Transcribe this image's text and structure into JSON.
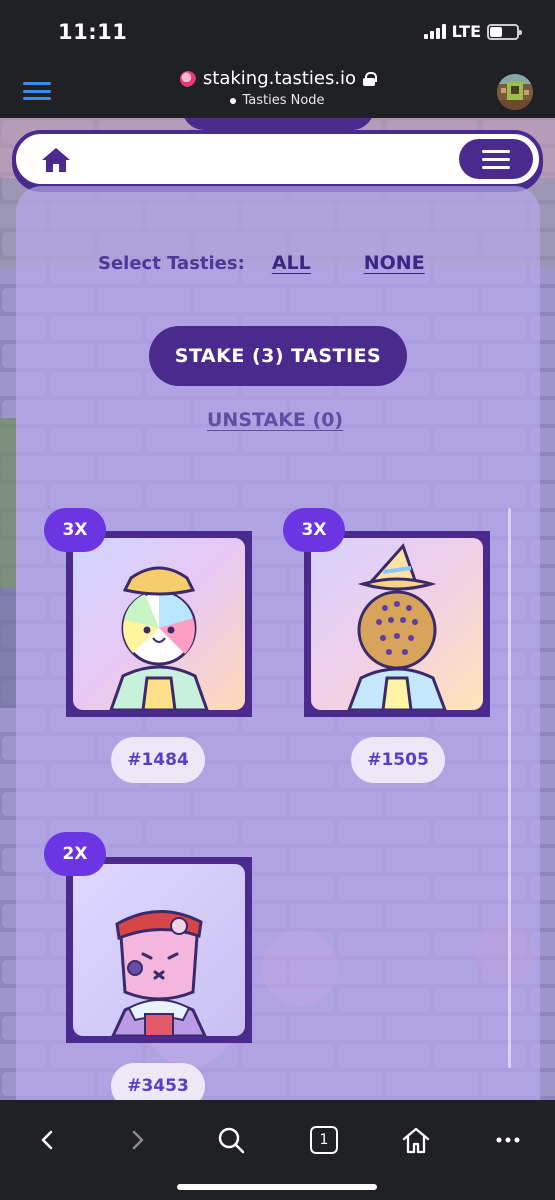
{
  "status_bar": {
    "time": "11:11",
    "network": "LTE"
  },
  "browser": {
    "url": "staking.tasties.io",
    "subtitle": "Tasties Node"
  },
  "select": {
    "label": "Select Tasties:",
    "all": "ALL",
    "none": "NONE"
  },
  "actions": {
    "stake": "STAKE (3) TASTIES",
    "unstake": "UNSTAKE (0)"
  },
  "nfts": [
    {
      "id": "#1484",
      "multiplier": "3X"
    },
    {
      "id": "#1505",
      "multiplier": "3X"
    },
    {
      "id": "#3453",
      "multiplier": "2X"
    }
  ],
  "toolbar": {
    "tab_count": "1"
  },
  "colors": {
    "brand_purple": "#4a2a8c",
    "badge_purple": "#6b35e3",
    "link_blue": "#3b8eea"
  }
}
